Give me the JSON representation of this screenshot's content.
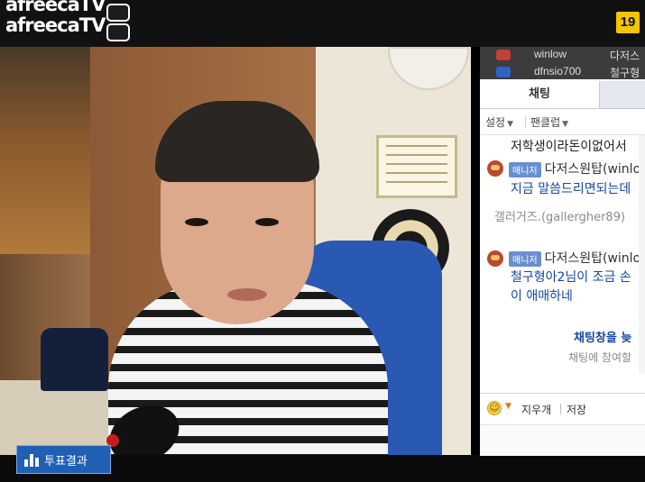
{
  "app": {
    "logo_text": "afreecaTV",
    "age_rating": "19"
  },
  "video": {
    "vote_results_label": "투표결과"
  },
  "user_list": [
    {
      "name": "winlow",
      "nickname": "다저스"
    },
    {
      "name": "dfnsio700",
      "nickname": "철구형"
    }
  ],
  "chat_panel": {
    "tab_chat": "채팅",
    "toolbar": {
      "settings_label": "설정",
      "fanclub_label": "팬클럽"
    },
    "messages": [
      {
        "text": "저학생이라돈이없어서",
        "style": "dark"
      },
      {
        "badge": "매니저",
        "sender": "다저스원탑(winlow)",
        "text": "지금 말씀드리면되는데",
        "style": "blue"
      },
      {
        "sender": "갤러거즈.(gallergher89)",
        "text": "",
        "style": "gray"
      },
      {
        "badge": "매니저",
        "sender": "다저스원탑(winlow)",
        "text": "철구형아2님이 조금 손",
        "text2": "이 애매하네",
        "style": "blue"
      }
    ],
    "notice_title": "채팅창을 늦",
    "notice_sub": "채팅에 참여할",
    "bottom": {
      "clear_label": "지우개",
      "save_label": "저장"
    }
  },
  "colors": {
    "accent_blue": "#1446a3",
    "manager_badge": "#6a8fd0",
    "age_badge": "#f5c500",
    "vote_button": "#1f5fb4"
  },
  "icons": {
    "vote": "bar-chart-icon",
    "emoticon": "smile-icon"
  }
}
